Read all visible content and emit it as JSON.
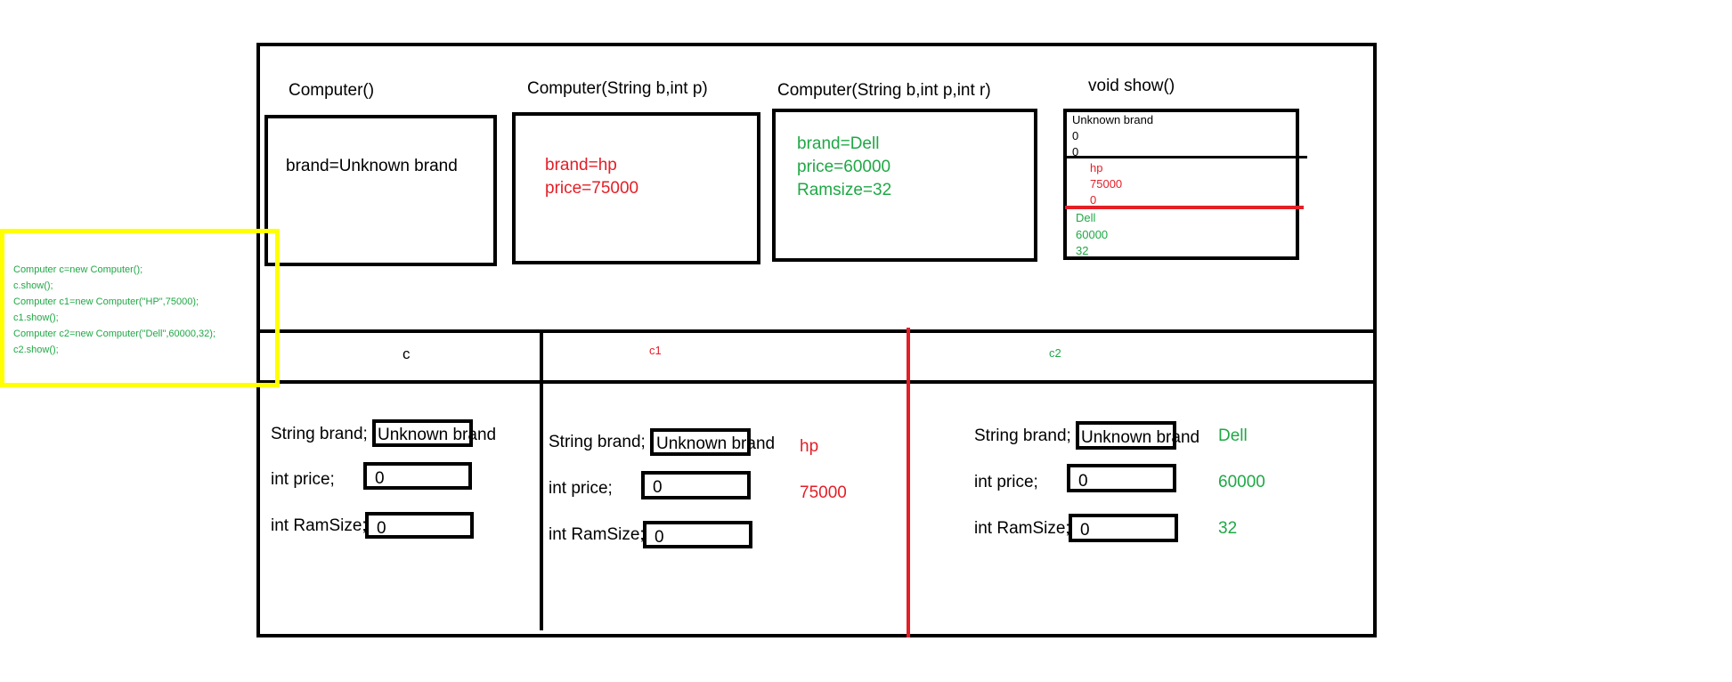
{
  "constructors": [
    {
      "title": "Computer()",
      "lines": [
        "brand=Unknown brand"
      ],
      "color": "#000000"
    },
    {
      "title": "Computer(String b,int p)",
      "lines": [
        "brand=hp",
        "price=75000"
      ],
      "color": "#e41e26"
    },
    {
      "title": "Computer(String b,int p,int r)",
      "lines": [
        "brand=Dell",
        "price=60000",
        "Ramsize=32"
      ],
      "color": "#1fa845"
    }
  ],
  "show": {
    "title": "void show()",
    "sections": [
      {
        "lines": [
          "Unknown brand",
          "0",
          "0"
        ],
        "color": "#000000"
      },
      {
        "lines": [
          "hp",
          "75000",
          "0"
        ],
        "color": "#e41e26"
      },
      {
        "lines": [
          "Dell",
          "60000",
          "32"
        ],
        "color": "#1fa845"
      }
    ]
  },
  "code_lines": [
    "Computer c=new Computer();",
    "c.show();",
    "Computer c1=new Computer(\"HP\",75000);",
    "c1.show();",
    "Computer c2=new Computer(\"Dell\",60000,32);",
    "c2.show();"
  ],
  "objects": [
    {
      "name": "c",
      "name_color": "#000000",
      "fields": [
        {
          "label": "String brand;",
          "box_value": "Unknown brand",
          "assigned": ""
        },
        {
          "label": "int price;",
          "box_value": "0",
          "assigned": ""
        },
        {
          "label": "int RamSize;",
          "box_value": "0",
          "assigned": ""
        }
      ]
    },
    {
      "name": "c1",
      "name_color": "#e41e26",
      "fields": [
        {
          "label": "String brand;",
          "box_value": "Unknown brand",
          "assigned": "hp"
        },
        {
          "label": "int price;",
          "box_value": "0",
          "assigned": "75000"
        },
        {
          "label": "int RamSize;",
          "box_value": "0",
          "assigned": ""
        }
      ]
    },
    {
      "name": "c2",
      "name_color": "#1fa845",
      "fields": [
        {
          "label": "String brand;",
          "box_value": "Unknown brand",
          "assigned": "Dell"
        },
        {
          "label": "int price;",
          "box_value": "0",
          "assigned": "60000"
        },
        {
          "label": "int RamSize;",
          "box_value": "0",
          "assigned": "32"
        }
      ]
    }
  ]
}
